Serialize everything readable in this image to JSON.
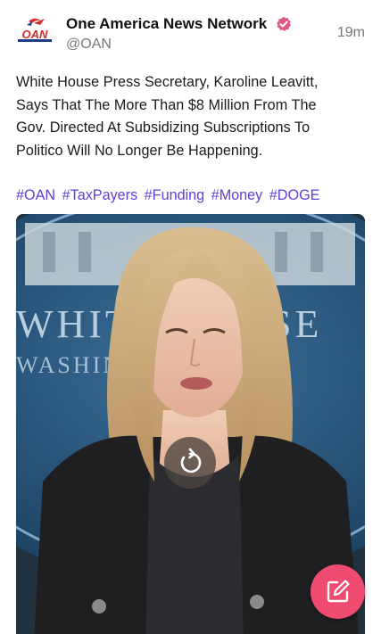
{
  "post": {
    "author": {
      "display_name": "One America News Network",
      "handle": "@OAN",
      "verified": true,
      "avatar": {
        "logo_text": "OAN",
        "icon": "oan-logo-icon"
      }
    },
    "time_ago": "19m",
    "text_lines": [
      "White House Press Secretary, Karoline Leavitt,",
      "Says That The More Than $8 Million From The",
      "Gov. Directed At Subsidizing Subscriptions To",
      "Politico Will No Longer Be Happening."
    ],
    "hashtags": [
      "#OAN",
      "#TaxPayers",
      "#Funding",
      "#Money",
      "#DOGE"
    ],
    "video": {
      "background_sign_text": "WHITE HOUSE",
      "background_sign_subtext": "WASHINGTON",
      "overlay_icon": "replay-icon"
    }
  },
  "fab": {
    "icon": "compose-icon"
  },
  "colors": {
    "hashtag": "#5f3fd6",
    "verified_badge": "#e2568a",
    "fab": "#ef4a6f",
    "oan_red": "#d42a2a",
    "oan_blue": "#1f3a86"
  }
}
